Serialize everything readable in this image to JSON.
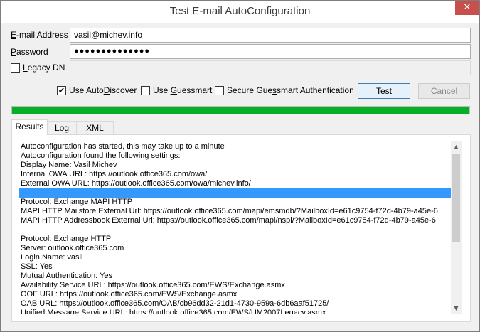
{
  "window": {
    "title": "Test E-mail AutoConfiguration",
    "close_glyph": "✕"
  },
  "form": {
    "email_label": "E-mail Address",
    "email_value": "vasil@michev.info",
    "password_label": "Password",
    "password_value": "●●●●●●●●●●●●●●",
    "legacy_label": "Legacy DN",
    "legacy_value": ""
  },
  "options": {
    "autodiscover_label": "Use AutoDiscover",
    "autodiscover_checked": "✔",
    "guessmart_label": "Use Guessmart",
    "secure_label": "Secure Guessmart Authentication"
  },
  "buttons": {
    "test": "Test",
    "cancel": "Cancel"
  },
  "progress": {
    "value_percent": 100,
    "color": "#06b025"
  },
  "tabs": [
    {
      "label": "Results",
      "active": true
    },
    {
      "label": "Log",
      "active": false
    },
    {
      "label": "XML",
      "active": false
    }
  ],
  "results": {
    "lines": [
      "Autoconfiguration has started, this may take up to a minute",
      "Autoconfiguration found the following settings:",
      "Display Name: Vasil Michev",
      "Internal OWA URL: https://outlook.office365.com/owa/",
      "External OWA URL: https://outlook.office365.com/owa/michev.info/",
      "",
      "Protocol: Exchange MAPI HTTP",
      "MAPI HTTP Mailstore External Url: https://outlook.office365.com/mapi/emsmdb/?MailboxId=e61c9754-f72d-4b79-a45e-6",
      "MAPI HTTP Addressbook External Url: https://outlook.office365.com/mapi/nspi/?MailboxId=e61c9754-f72d-4b79-a45e-6",
      "",
      "Protocol: Exchange HTTP",
      "Server: outlook.office365.com",
      "Login Name: vasil",
      "SSL: Yes",
      "Mutual Authentication: Yes",
      "Availability Service URL: https://outlook.office365.com/EWS/Exchange.asmx",
      "OOF URL: https://outlook.office365.com/EWS/Exchange.asmx",
      "OAB URL: https://outlook.office365.com/OAB/cb96dd32-21d1-4730-959a-6db6aaf51725/",
      "Unified Message Service URL: https://outlook.office365.com/EWS/UM2007Legacy.asmx"
    ]
  },
  "scrollbar": {
    "up_glyph": "▲",
    "down_glyph": "▼"
  }
}
